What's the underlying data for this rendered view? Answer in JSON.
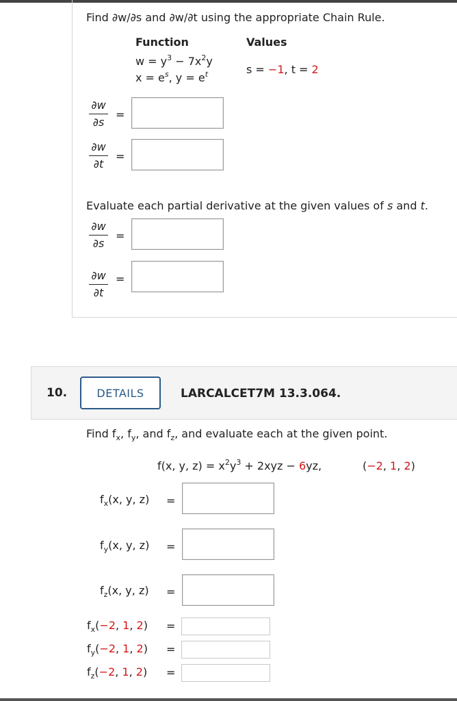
{
  "q9": {
    "instruction": "Find ∂w/∂s and ∂w/∂t using the appropriate Chain Rule.",
    "function_header": "Function",
    "values_header": "Values",
    "func_line1": {
      "w": "w = y",
      "exp3": "3",
      "minus": " − 7x",
      "exp2": "2",
      "y": "y"
    },
    "func_line2": {
      "x": "x = e",
      "s": "s",
      "comma": ",  y = e",
      "t": "t"
    },
    "values_line": {
      "s_label": "s = ",
      "s_val": "−1",
      "sep": ",  t = ",
      "t_val": "2"
    },
    "partials": [
      {
        "num": "∂w",
        "den": "∂s",
        "eq": "="
      },
      {
        "num": "∂w",
        "den": "∂t",
        "eq": "="
      }
    ],
    "evaluate_text": "Evaluate each partial derivative at the given values of s and t.",
    "evaluate_parts": {
      "pre": "Evaluate each partial derivative at the given values of ",
      "s": "s",
      "and": " and ",
      "t": "t",
      "dot": "."
    },
    "eval_partials": [
      {
        "num": "∂w",
        "den": "∂s",
        "eq": "="
      },
      {
        "num": "∂w",
        "den": "∂t",
        "eq": "="
      }
    ]
  },
  "q10": {
    "number": "10.",
    "details_label": "DETAILS",
    "code": "LARCALCET7M 13.3.064.",
    "instruction": {
      "pre": "Find f",
      "x": "x",
      "c1": ", f",
      "y": "y",
      "c2": ", and f",
      "z": "z",
      "post": ", and evaluate each at the given point."
    },
    "function": {
      "lhs": "f(x, y, z) = x",
      "e2": "2",
      "y": "y",
      "e3": "3",
      "mid": " + 2xyz − ",
      "six": "6",
      "tail": "yz,",
      "pt_open": "(",
      "p1": "−2",
      "c1": ", ",
      "p2": "1",
      "c2": ", ",
      "p3": "2",
      "pt_close": ")"
    },
    "partials": [
      {
        "f": "f",
        "sub": "x",
        "args": "(x, y, z)",
        "eq": "="
      },
      {
        "f": "f",
        "sub": "y",
        "args": "(x, y, z)",
        "eq": "="
      },
      {
        "f": "f",
        "sub": "z",
        "args": "(x, y, z)",
        "eq": "="
      }
    ],
    "evaluated": [
      {
        "f": "f",
        "sub": "x",
        "open": "(",
        "a": "−2",
        "c1": ", ",
        "b": "1",
        "c2": ", ",
        "c": "2",
        "close": ")",
        "eq": "="
      },
      {
        "f": "f",
        "sub": "y",
        "open": "(",
        "a": "−2",
        "c1": ", ",
        "b": "1",
        "c2": ", ",
        "c": "2",
        "close": ")",
        "eq": "="
      },
      {
        "f": "f",
        "sub": "z",
        "open": "(",
        "a": "−2",
        "c1": ", ",
        "b": "1",
        "c2": ", ",
        "c": "2",
        "close": ")",
        "eq": "="
      }
    ]
  },
  "colors": {
    "red": "#d41717",
    "details_blue": "#2a5a88",
    "header_bg": "#f4f4f4"
  }
}
